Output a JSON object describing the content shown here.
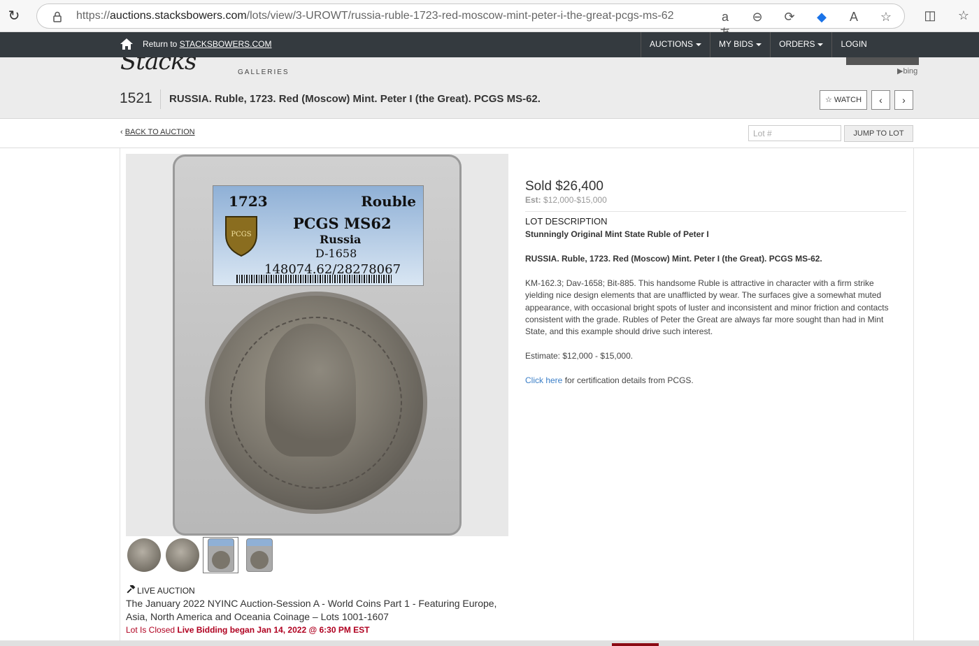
{
  "browser": {
    "url_prefix": "https://",
    "url_host": "auctions.stacksbowers.com",
    "url_path": "/lots/view/3-UROWT/russia-ruble-1723-red-moscow-mint-peter-i-the-great-pcgs-ms-62"
  },
  "topnav": {
    "return_text": "Return to",
    "return_link": "STACKSBOWERS.COM",
    "items": [
      "AUCTIONS",
      "MY BIDS",
      "ORDERS",
      "LOGIN"
    ]
  },
  "header": {
    "logo_text": "Stacks Bowers",
    "logo_sub": "GALLERIES",
    "bing": "bing",
    "lot_number": "1521",
    "lot_title": "RUSSIA. Ruble, 1723. Red (Moscow) Mint. Peter I (the Great). PCGS MS-62.",
    "watch_label": "WATCH"
  },
  "subbar": {
    "back_label": "BACK TO AUCTION",
    "lot_placeholder": "Lot #",
    "jump_label": "JUMP TO LOT"
  },
  "slab_label": {
    "year": "1723",
    "denomination": "Rouble",
    "grade": "PCGS MS62",
    "country": "Russia",
    "reference": "D-1658",
    "cert": "148074.62/28278067",
    "shield": "PCGS"
  },
  "auction": {
    "live_label": "LIVE AUCTION",
    "name": "The January 2022 NYINC Auction-Session A - World Coins Part 1 - Featuring Europe, Asia, North America and Oceania Coinage – Lots 1001-1607",
    "status": "Lot Is Closed",
    "bidding": "Live Bidding began Jan 14, 2022 @ 6:30 PM EST"
  },
  "lot": {
    "sold": "Sold $26,400",
    "est_label": "Est:",
    "est_value": "$12,000-$15,000",
    "description_heading": "LOT DESCRIPTION",
    "description_subtitle": "Stunningly Original Mint State Ruble of Peter I",
    "description_title": "RUSSIA. Ruble, 1723. Red (Moscow) Mint. Peter I (the Great). PCGS MS-62.",
    "description_body": "KM-162.3; Dav-1658; Bit-885. This handsome Ruble is attractive in character with a firm strike yielding nice design elements that are unafflicted by wear. The surfaces give a somewhat muted appearance, with occasional bright spots of luster and inconsistent and minor friction and contacts consistent with the grade. Rubles of Peter the Great are always far more sought than had in Mint State, and this example should drive such interest.",
    "estimate_text": "Estimate: $12,000 - $15,000.",
    "cert_link": "Click here",
    "cert_rest": " for certification details from PCGS."
  }
}
